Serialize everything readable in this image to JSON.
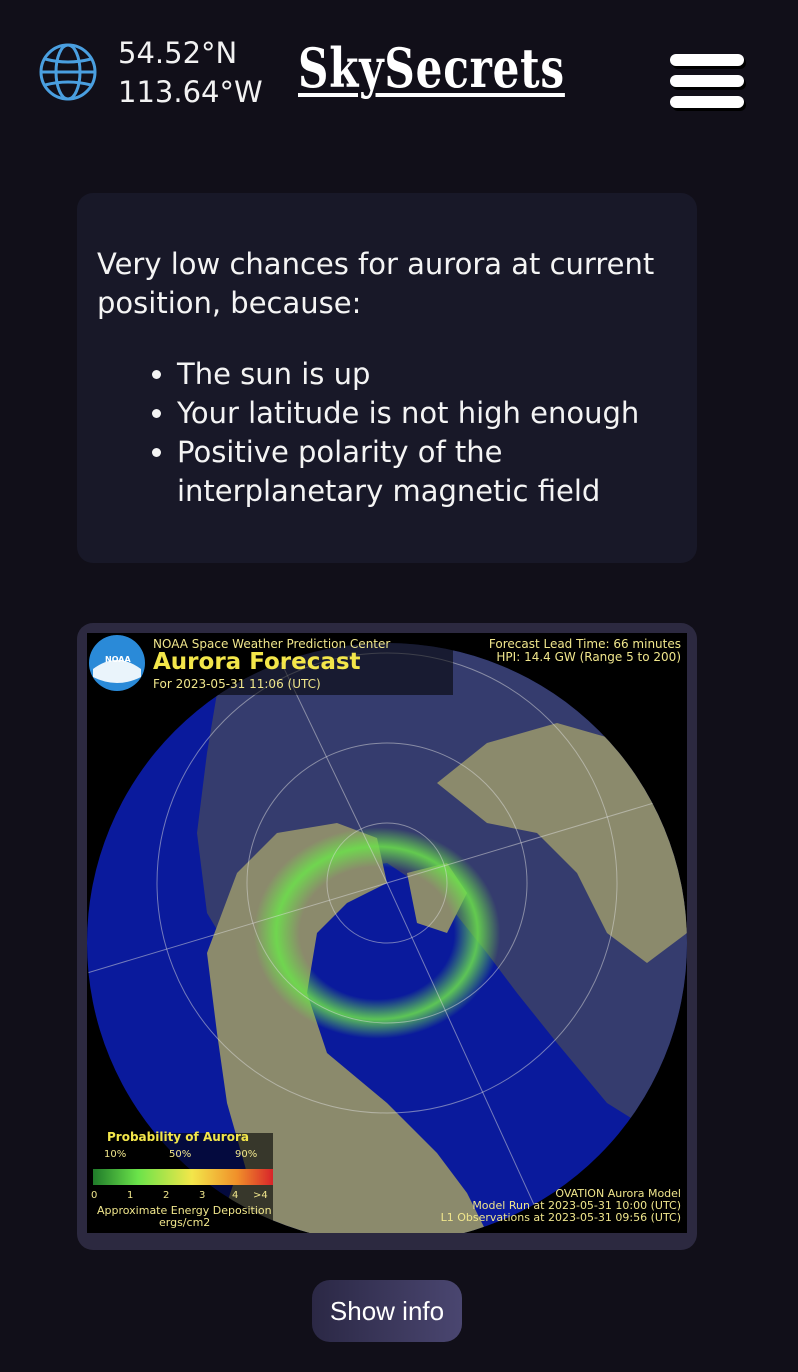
{
  "header": {
    "latitude": "54.52°N",
    "longitude": "113.64°W",
    "brand": "SkySecrets",
    "icons": {
      "location": "globe-icon",
      "menu": "hamburger-menu-icon"
    }
  },
  "status": {
    "lead": "Very low chances for aurora at current position, because:",
    "reasons": [
      "The sun is up",
      "Your latitude is not high enough",
      "Positive polarity of the interplanetary magnetic field"
    ]
  },
  "forecast": {
    "logo_text": "NOAA",
    "provider": "NOAA Space Weather Prediction Center",
    "title": "Aurora Forecast",
    "for_date": "For 2023-05-31 11:06 (UTC)",
    "lead_time": "Forecast Lead Time:  66 minutes",
    "hpi": "HPI:  14.4 GW (Range 5 to 200)",
    "legend": {
      "title": "Probability of Aurora",
      "percent_ticks": [
        "10%",
        "50%",
        "90%"
      ],
      "energy_ticks": [
        "0",
        "1",
        "2",
        "3",
        "4",
        ">4"
      ],
      "caption_line1": "Approximate Energy Deposition",
      "caption_line2": "ergs/cm2"
    },
    "model": "OVATION Aurora Model",
    "model_run": "Model Run at 2023-05-31 10:00 (UTC)",
    "observations": "L1 Observations at 2023-05-31 09:56 (UTC)"
  },
  "colors": {
    "background": "#110f19",
    "card": "#181828",
    "frame": "#2c2940",
    "ocean": "#0a1a9c",
    "land": "#8b8a6c",
    "aurora": "#6be34a",
    "legend_text": "#f0e68c"
  },
  "show_info_label": "Show info"
}
